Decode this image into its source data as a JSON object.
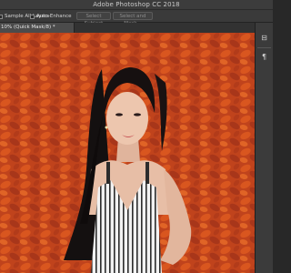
{
  "window": {
    "title": "Adobe Photoshop CC 2018"
  },
  "options_bar": {
    "sample_all_layers": "Sample All Layers",
    "auto_enhance": "Auto-Enhance",
    "select_subject": "Select Subject",
    "select_and_mask": "Select and Mask..."
  },
  "document": {
    "tab_label": "10% (Quick Mask/8) *"
  },
  "right_panel": {
    "icons": [
      "adjust-icon",
      "paragraph-icon"
    ]
  },
  "colors": {
    "canvas_leaves": "#c4461d",
    "panel_bg": "#3b3b3b",
    "ui_dark": "#282828"
  }
}
